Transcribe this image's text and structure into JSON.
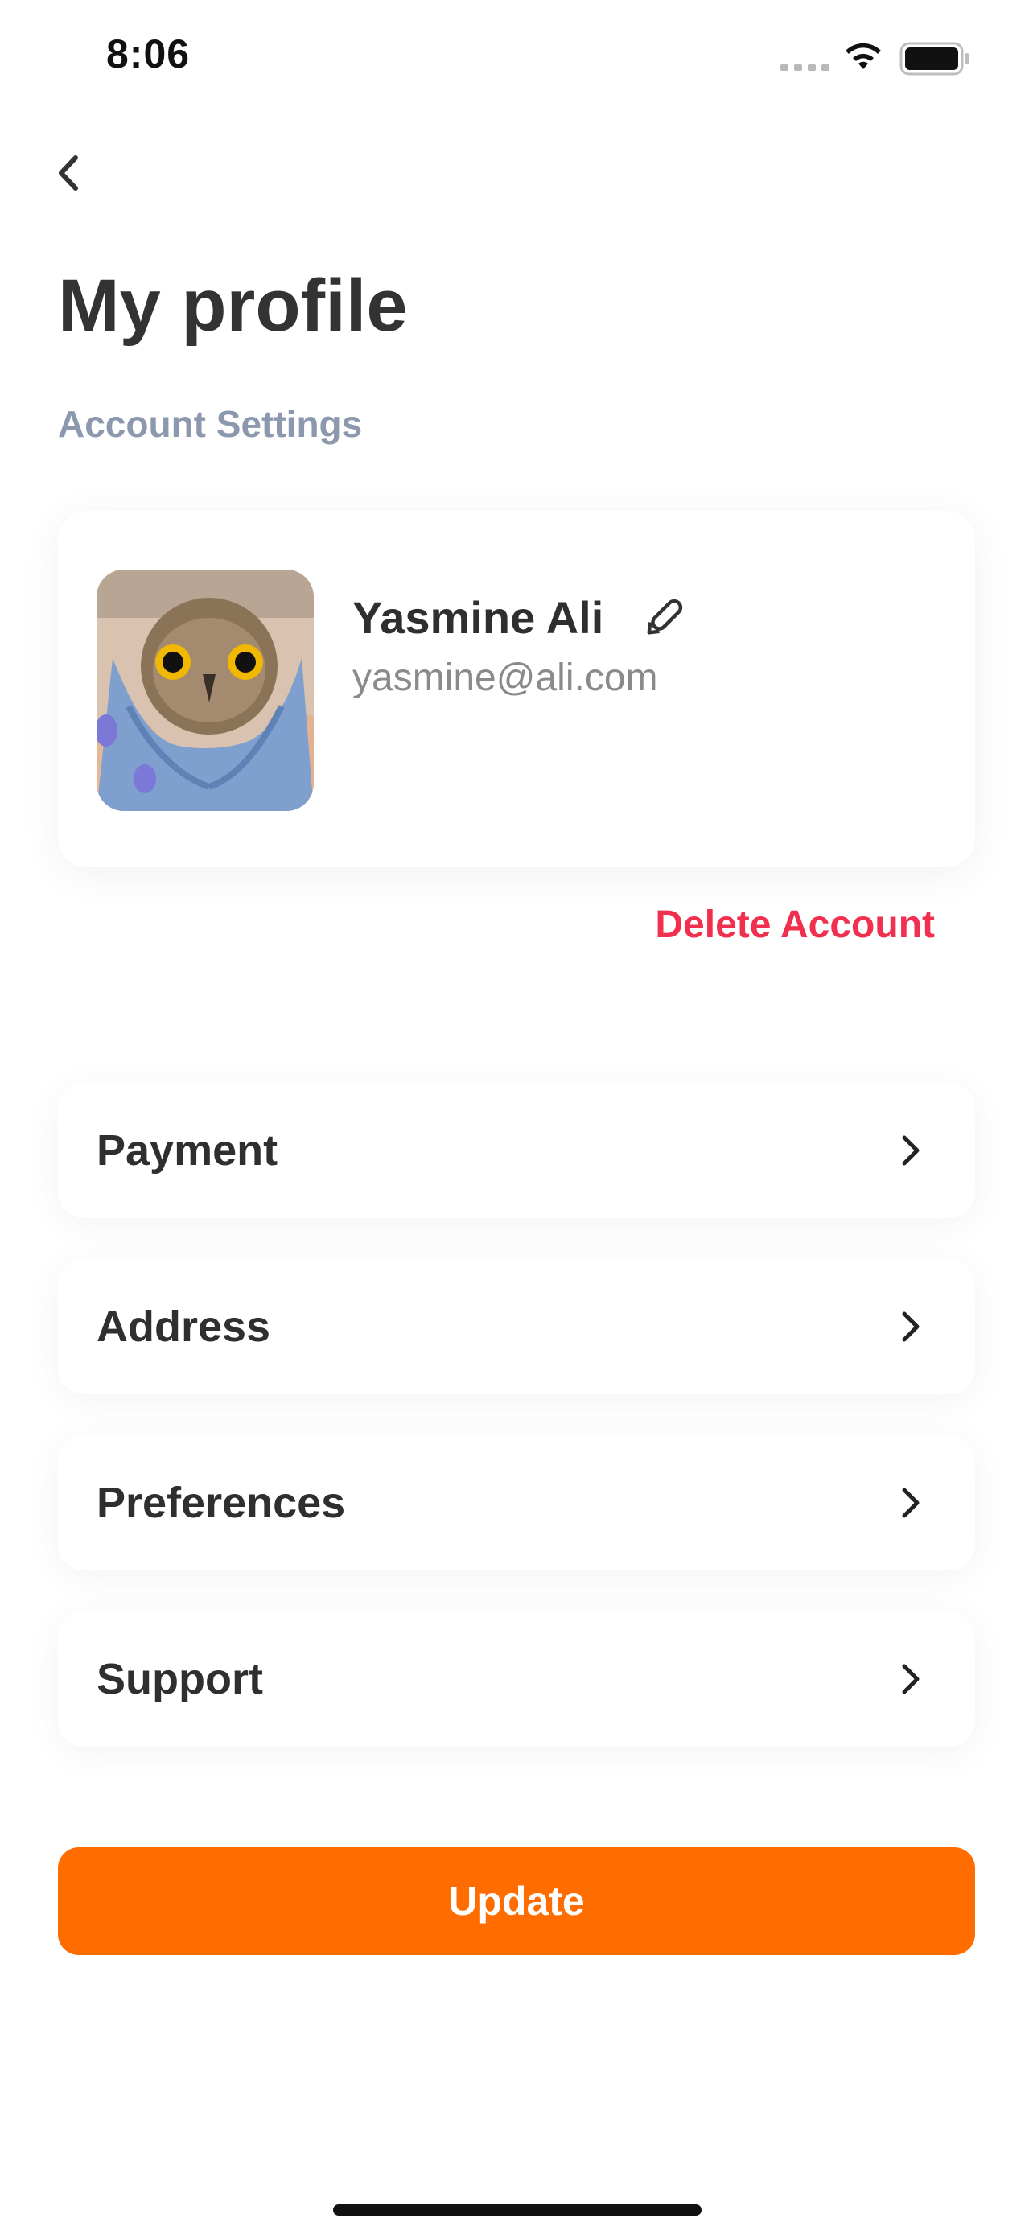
{
  "status_bar": {
    "time": "8:06"
  },
  "header": {
    "title": "My profile",
    "subtitle": "Account Settings"
  },
  "profile": {
    "name": "Yasmine Ali",
    "email": "yasmine@ali.com",
    "avatar_icon": "owl-photo"
  },
  "actions": {
    "delete_label": "Delete Account",
    "update_label": "Update"
  },
  "menu": [
    {
      "label": "Payment"
    },
    {
      "label": "Address"
    },
    {
      "label": "Preferences"
    },
    {
      "label": "Support"
    }
  ],
  "colors": {
    "accent": "#ff6d00",
    "danger": "#f1304f",
    "subtitle": "#8c98ad"
  }
}
